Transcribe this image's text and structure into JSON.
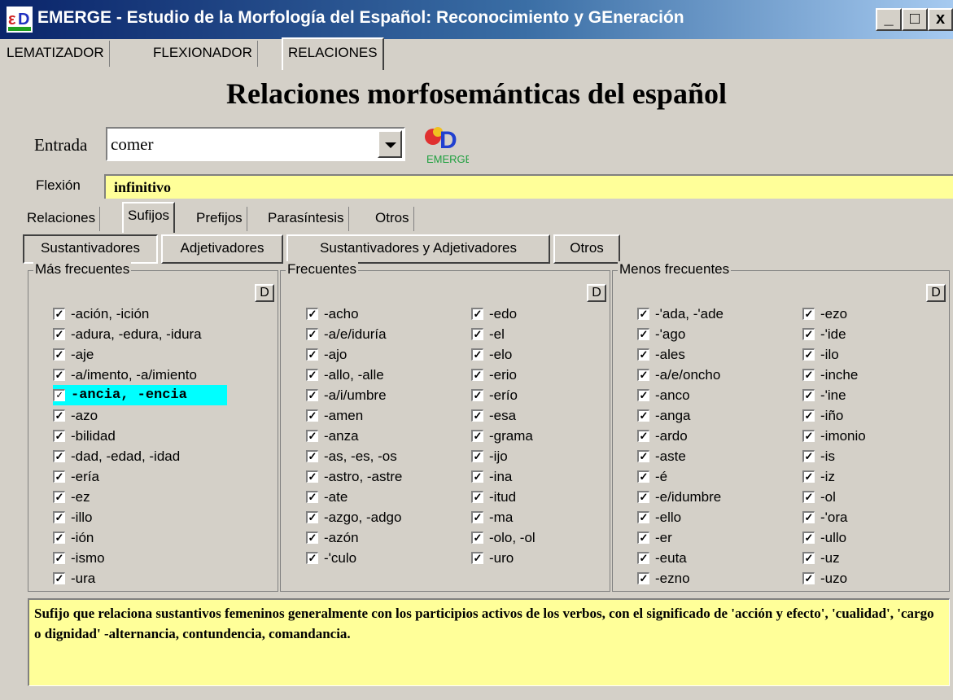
{
  "window": {
    "title": "EMERGE - Estudio de la Morfología del Español: Reconocimiento y GEneración",
    "minimize": "_",
    "maximize": "□",
    "close": "x"
  },
  "tabs": [
    {
      "label": "LEMATIZADOR"
    },
    {
      "label": "FLEXIONADOR"
    },
    {
      "label": "RELACIONES"
    }
  ],
  "heading": "Relaciones morfosemánticas del español",
  "entrada": {
    "label": "Entrada",
    "value": "comer"
  },
  "logo": {
    "text": "EMERGE"
  },
  "flexion": {
    "label": "Flexión",
    "value": "infinitivo"
  },
  "subtabs": [
    {
      "label": "Relaciones"
    },
    {
      "label": "Sufijos"
    },
    {
      "label": "Prefijos"
    },
    {
      "label": "Parasíntesis"
    },
    {
      "label": "Otros"
    }
  ],
  "buttons": [
    {
      "label": "Sustantivadores"
    },
    {
      "label": "Adjetivadores"
    },
    {
      "label": "Sustantivadores y Adjetivadores"
    },
    {
      "label": "Otros"
    }
  ],
  "check_mark": "✓",
  "groups": [
    {
      "title": "Más frecuentes",
      "d_label": "D",
      "columns": [
        [
          "-ación, -ición",
          "-adura, -edura, -idura",
          "-aje",
          "-a/imento, -a/imiento",
          "-ancia, -encia",
          "-azo",
          "-bilidad",
          "-dad, -edad, -idad",
          "-ería",
          "-ez",
          "-illo",
          "-ión",
          "-ismo",
          "-ura"
        ]
      ]
    },
    {
      "title": "Frecuentes",
      "d_label": "D",
      "columns": [
        [
          "-acho",
          "-a/e/iduría",
          "-ajo",
          "-allo, -alle",
          "-a/i/umbre",
          "-amen",
          "-anza",
          "-as, -es, -os",
          "-astro, -astre",
          "-ate",
          "-azgo, -adgo",
          "-azón",
          "-'culo"
        ],
        [
          "-edo",
          "-el",
          "-elo",
          "-erio",
          "-erío",
          "-esa",
          "-grama",
          "-ijo",
          "-ina",
          "-itud",
          "-ma",
          "-olo, -ol",
          "-uro"
        ]
      ]
    },
    {
      "title": "Menos frecuentes",
      "d_label": "D",
      "columns": [
        [
          "-'ada, -'ade",
          "-'ago",
          "-ales",
          "-a/e/oncho",
          "-anco",
          "-anga",
          "-ardo",
          "-aste",
          "-é",
          "-e/idumbre",
          "-ello",
          "-er",
          "-euta",
          "-ezno"
        ],
        [
          "-ezo",
          "-'ide",
          "-ilo",
          "-inche",
          "-'ine",
          "-iño",
          "-imonio",
          "-is",
          "-iz",
          "-ol",
          "-'ora",
          "-ullo",
          "-uz",
          "-uzo"
        ]
      ]
    }
  ],
  "highlighted": "-ancia, -encia",
  "description": "Sufijo que relaciona sustantivos femeninos generalmente con los participios activos de los verbos, con el significado de 'acción y efecto', 'cualidad', 'cargo o dignidad' -alternancia, contundencia, comandancia."
}
